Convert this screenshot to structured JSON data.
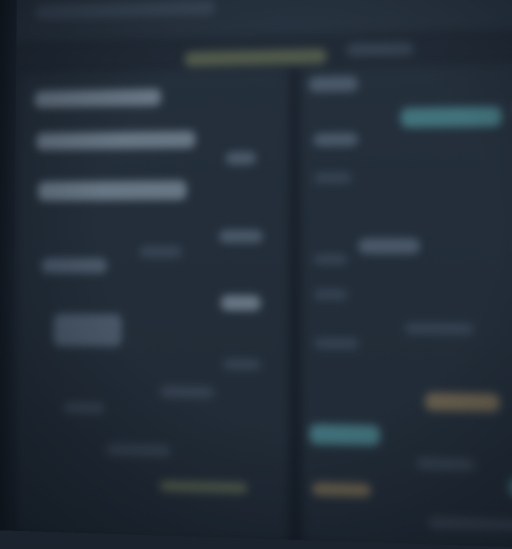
{
  "theme": {
    "background": "#1b232e",
    "panel": "#283442",
    "text_bar": "#6b7c8f",
    "highlight_bar": "#98a8b8",
    "accent_teal": "#57a2a8",
    "accent_gold": "#a48a5e",
    "accent_olive": "#7f8a5e"
  },
  "note_text_legible": false
}
